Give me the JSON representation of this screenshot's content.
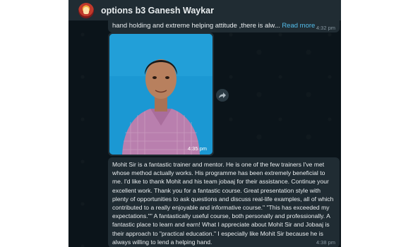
{
  "header": {
    "title": "options b3 Ganesh Waykar"
  },
  "messages": [
    {
      "text": "hand holding and extreme helping attitude ,there is alw...",
      "read_more": "Read more",
      "time": "4:32 pm"
    },
    {
      "type": "image",
      "time": "4:35 pm"
    },
    {
      "text": "Mohit Sir is a fantastic trainer and mentor. He is one of the few trainers I've met whose method actually works. His programme has been extremely beneficial to me. I'd like to thank Mohit and his team jobaaj for their assistance. Continue your excellent work. Thank you for a fantastic course. Great presentation style with plenty of opportunities to ask questions and discuss real-life examples, all of which contributed to a really enjoyable and informative course.\" \"This has exceeded my expectations.\"\" A fantastically useful course, both personally and professionally. A fantastic place to learn and earn! What I appreciate about Mohit Sir and Jobaaj is their approach to \"practical education.\" I especially like Mohit Sir because he is always willing to lend a helping hand.",
      "time": "4:38 pm"
    }
  ],
  "icons": {
    "forward": "forward-arrow-icon",
    "avatar": "group-avatar"
  },
  "colors": {
    "chat_bg": "#0b141a",
    "bubble_bg": "#202c33",
    "header_bg": "#202c33",
    "link": "#53bdeb",
    "time": "#8696a0"
  }
}
